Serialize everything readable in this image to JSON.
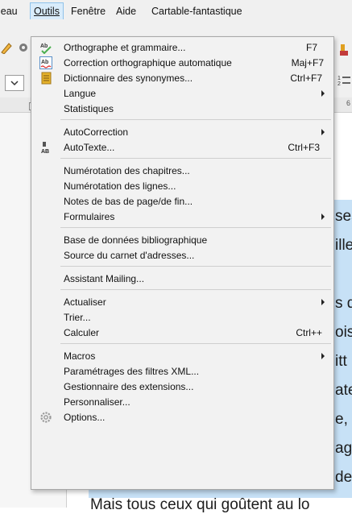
{
  "menubar": {
    "items": [
      {
        "label": "leau"
      },
      {
        "label": "Outils"
      },
      {
        "label": "Fenêtre"
      },
      {
        "label": "Aide"
      },
      {
        "label": "Cartable-fantastique"
      }
    ]
  },
  "menu": {
    "items": [
      {
        "label": "Orthographe et grammaire...",
        "shortcut": "F7",
        "icon": "spellcheck-icon"
      },
      {
        "label": "Correction orthographique automatique",
        "shortcut": "Maj+F7",
        "icon": "autospellcheck-icon"
      },
      {
        "label": "Dictionnaire des synonymes...",
        "shortcut": "Ctrl+F7",
        "icon": "thesaurus-icon"
      },
      {
        "label": "Langue"
      },
      {
        "label": "Statistiques"
      },
      {
        "label": "AutoCorrection"
      },
      {
        "label": "AutoTexte...",
        "shortcut": "Ctrl+F3",
        "icon": "autotext-icon"
      },
      {
        "label": "Numérotation des chapitres..."
      },
      {
        "label": "Numérotation des lignes..."
      },
      {
        "label": "Notes de bas de page/de fin..."
      },
      {
        "label": "Formulaires"
      },
      {
        "label": "Base de données bibliographique"
      },
      {
        "label": "Source du carnet d'adresses..."
      },
      {
        "label": "Assistant Mailing..."
      },
      {
        "label": "Actualiser"
      },
      {
        "label": "Trier..."
      },
      {
        "label": "Calculer",
        "shortcut": "Ctrl++"
      },
      {
        "label": "Macros"
      },
      {
        "label": "Paramétrages des filtres XML..."
      },
      {
        "label": "Gestionnaire des extensions..."
      },
      {
        "label": "Personnaliser..."
      },
      {
        "label": "Options...",
        "icon": "options-gear-icon"
      }
    ]
  },
  "document": {
    "fragments": [
      "ses",
      "ille",
      "s d",
      "ois",
      "itt",
      "ate",
      "e, ",
      "ag",
      "de"
    ],
    "bottom_line": "Mais tous ceux qui goûtent au lo"
  },
  "toolbar": {
    "ruler_mark": "6"
  },
  "colors": {
    "menu_bg": "#f2f2f2",
    "selection": "#c7e1f6",
    "active_menubar": "#d9ecfb"
  }
}
